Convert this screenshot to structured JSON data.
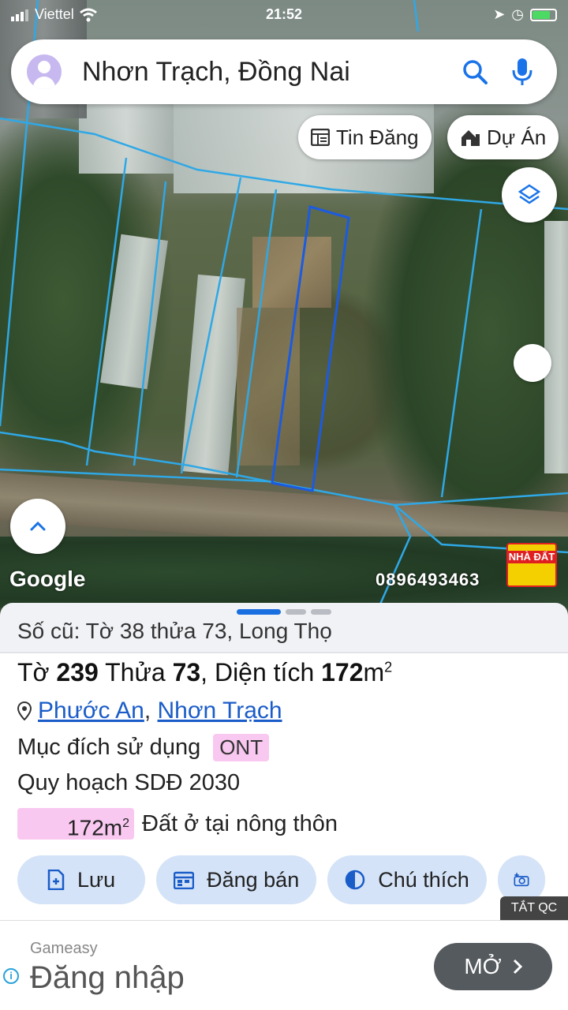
{
  "status_bar": {
    "carrier": "Viettel",
    "time": "21:52"
  },
  "search": {
    "query": "Nhơn Trạch, Đồng Nai"
  },
  "map_chips": {
    "news_label": "Tin Đăng",
    "project_label": "Dự Án"
  },
  "map_overlay": {
    "google_label": "Google",
    "phone": "0896493463",
    "logo_text": "NHÀ ĐẤT"
  },
  "parcel": {
    "old_ref": "Số cũ: Tờ 38 thửa 73, Long Thọ",
    "sheet_prefix": "Tờ ",
    "sheet_no": "239",
    "plot_prefix": " Thửa ",
    "plot_no": "73",
    "area_prefix": ", Diện tích ",
    "area_value": "172",
    "area_unit": "m",
    "area_sup": "2",
    "ward": "Phước An",
    "district": "Nhơn Trạch",
    "purpose_label": "Mục đích sử dụng",
    "purpose_code": "ONT",
    "plan_label": "Quy hoạch SDĐ 2030",
    "plan_area": "172m",
    "plan_area_sup": "2",
    "plan_desc": "Đất ở tại nông thôn"
  },
  "actions": {
    "save": "Lưu",
    "sell": "Đăng bán",
    "legend": "Chú thích"
  },
  "ad": {
    "close_label": "TẮT QC",
    "brand": "Gameasy",
    "title": "Đăng nhập",
    "cta": "MỞ"
  }
}
